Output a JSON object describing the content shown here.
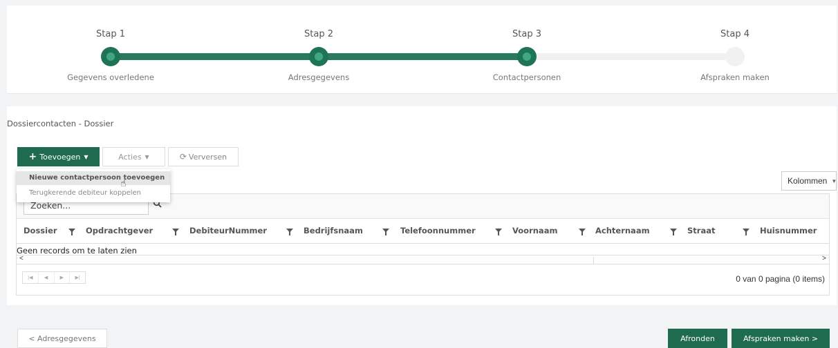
{
  "wizard": {
    "steps": [
      {
        "title": "Stap 1",
        "label": "Gegevens overledene",
        "state": "done"
      },
      {
        "title": "Stap 2",
        "label": "Adresgegevens",
        "state": "done"
      },
      {
        "title": "Stap 3",
        "label": "Contactpersonen",
        "state": "current"
      },
      {
        "title": "Stap 4",
        "label": "Afspraken maken",
        "state": "todo"
      }
    ]
  },
  "panel": {
    "title": "Dossiercontacten - Dossier"
  },
  "toolbar": {
    "add_label": "Toevoegen",
    "actions_label": "Acties",
    "refresh_label": "Verversen"
  },
  "dropdown": {
    "items": [
      {
        "label": "Nieuwe contactpersoon toevoegen"
      },
      {
        "label": "Terugkerende debiteur koppelen"
      }
    ]
  },
  "columns_button": "Kolommen",
  "search": {
    "placeholder": "Zoeken..."
  },
  "table": {
    "columns": [
      "Dossier",
      "Opdrachtgever",
      "DebiteurNummer",
      "Bedrijfsnaam",
      "Telefoonnummer",
      "Voornaam",
      "Achternaam",
      "Straat",
      "Huisnummer"
    ],
    "empty_text": "Geen records om te laten zien"
  },
  "pager": {
    "info": "0 van 0 pagina (0 items)"
  },
  "footer": {
    "back_label": "< Adresgegevens",
    "finish_label": "Afronden",
    "next_label": "Afspraken maken >"
  },
  "colors": {
    "accent": "#1e6b4f",
    "track": "#2a7a5d"
  }
}
